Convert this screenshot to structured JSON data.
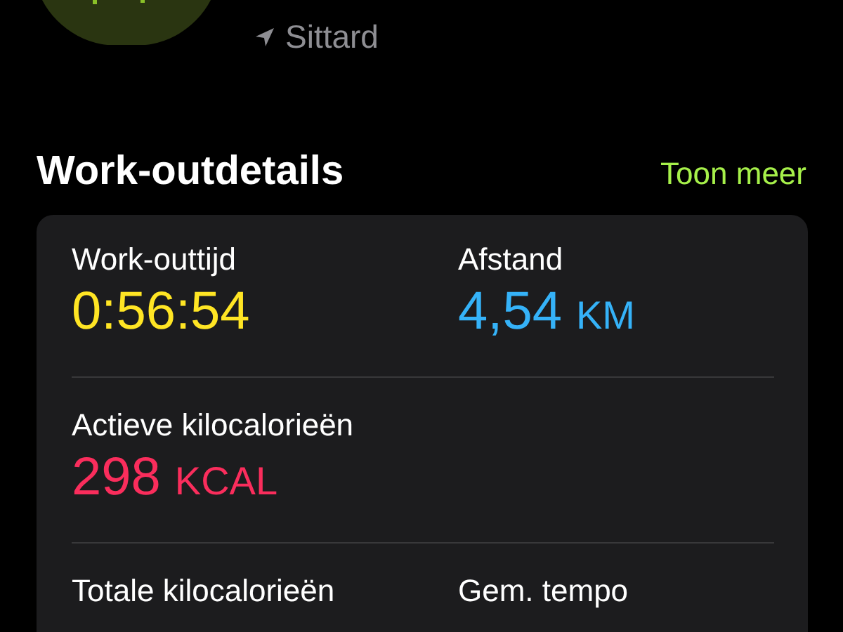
{
  "location": "Sittard",
  "section": {
    "title": "Work-outdetails",
    "link": "Toon meer"
  },
  "metrics": [
    {
      "label": "Work-outtijd",
      "value": "0:56:54",
      "color": "#ffe524"
    },
    {
      "label": "Afstand",
      "value": "4,54",
      "unit": "KM",
      "color": "#35b2f8"
    },
    {
      "label": "Actieve kilocalorieën",
      "value": "298",
      "unit": "KCAL",
      "color": "#fa2d5c"
    },
    {
      "label": "Totale kilocalorieën"
    },
    {
      "label": "Gem. tempo"
    }
  ]
}
